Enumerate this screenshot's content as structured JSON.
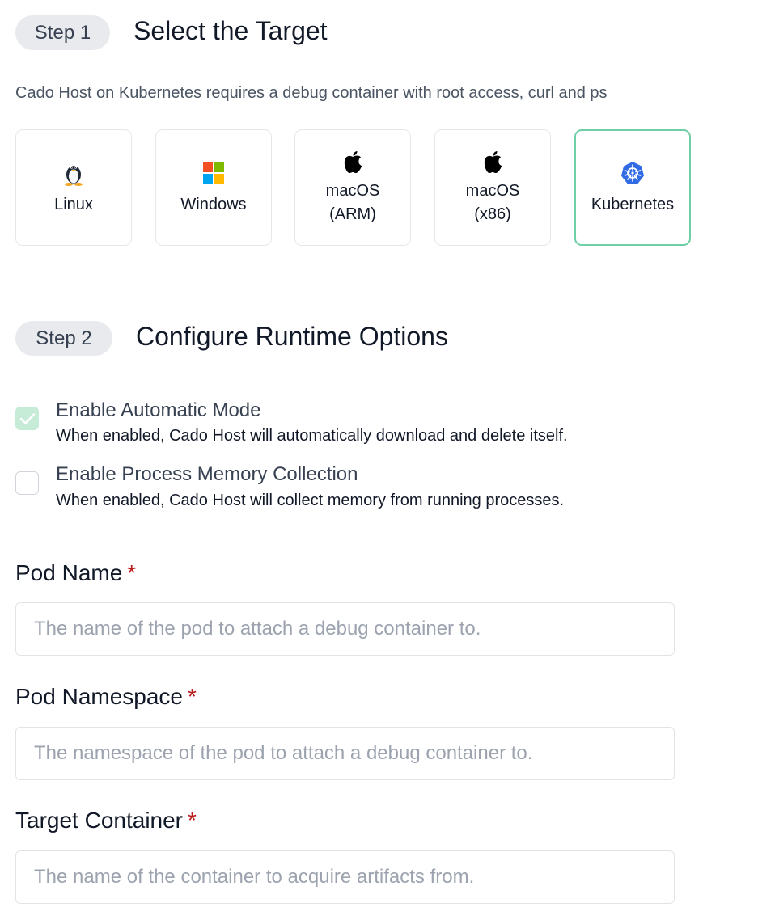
{
  "step1": {
    "pill": "Step 1",
    "title": "Select the Target",
    "description": "Cado Host on Kubernetes requires a debug container with root access, curl and ps"
  },
  "targets": [
    {
      "label": "Linux",
      "icon": "linux-penguin-icon"
    },
    {
      "label": "Windows",
      "icon": "windows-logo-icon"
    },
    {
      "label": "macOS\n(ARM)",
      "icon": "apple-icon"
    },
    {
      "label": "macOS\n(x86)",
      "icon": "apple-icon"
    },
    {
      "label": "Kubernetes",
      "icon": "kubernetes-icon",
      "selected": true
    }
  ],
  "step2": {
    "pill": "Step 2",
    "title": "Configure Runtime Options"
  },
  "options": [
    {
      "title": "Enable Automatic Mode",
      "description": "When enabled, Cado Host will automatically download and delete itself.",
      "checked": true
    },
    {
      "title": "Enable Process Memory Collection",
      "description": "When enabled, Cado Host will collect memory from running processes.",
      "checked": false
    }
  ],
  "fields": [
    {
      "label": "Pod Name",
      "required_mark": "*",
      "value": "",
      "placeholder": "The name of the pod to attach a debug container to."
    },
    {
      "label": "Pod Namespace",
      "required_mark": "*",
      "value": "",
      "placeholder": "The namespace of the pod to attach a debug container to."
    },
    {
      "label": "Target Container",
      "required_mark": "*",
      "value": "",
      "placeholder": "The name of the container to acquire artifacts from."
    }
  ],
  "colors": {
    "selected_border": "#6fcfa4",
    "checkbox_checked": "#c6ebd7",
    "required": "#b91c1c",
    "pill_bg": "#e8eaee",
    "kubernetes_blue": "#326ce5"
  }
}
